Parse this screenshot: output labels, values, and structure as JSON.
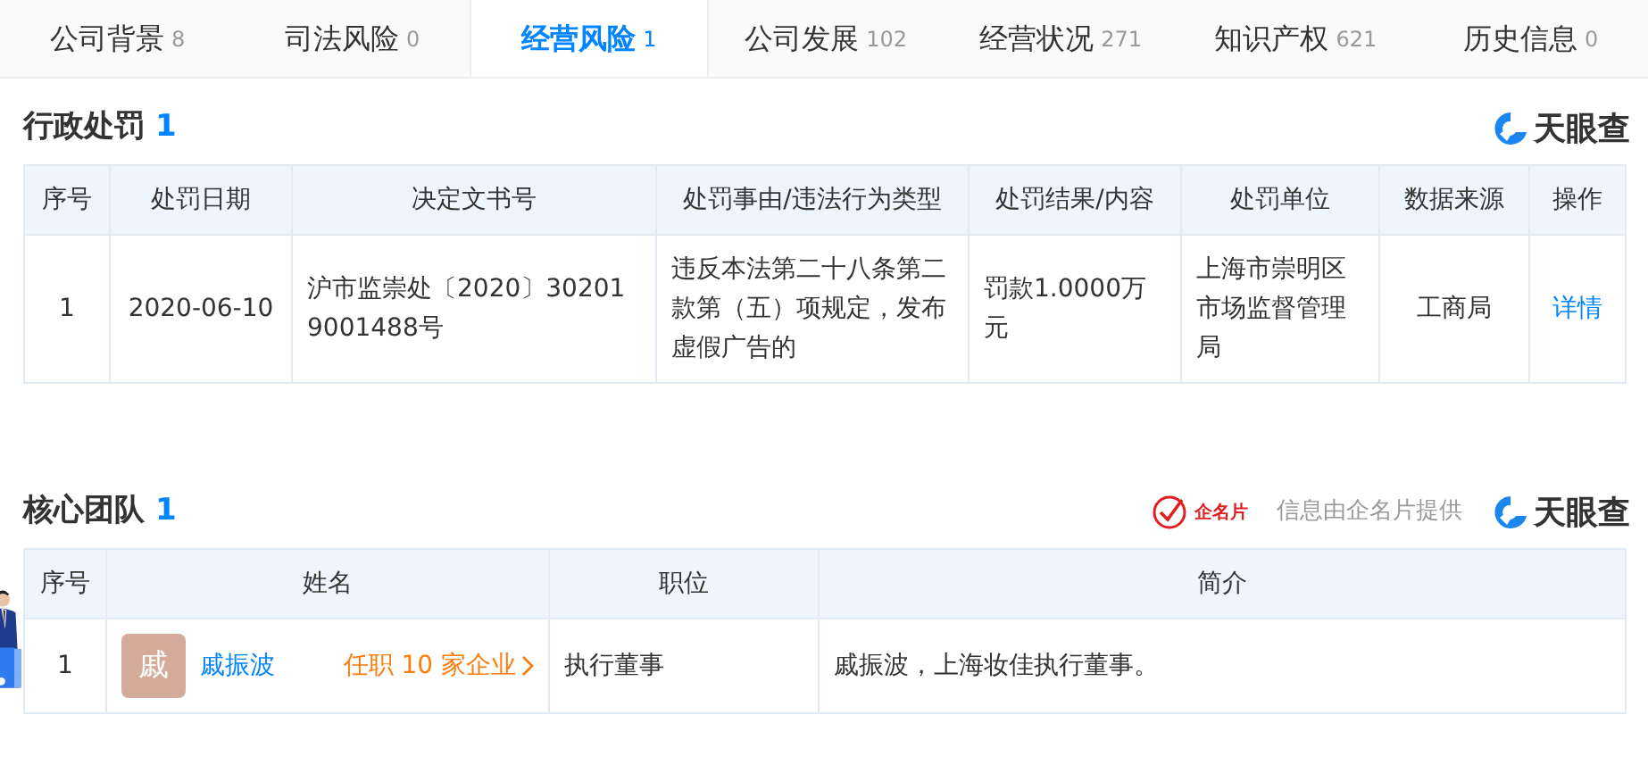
{
  "tabs": [
    {
      "label": "公司背景",
      "count": "8",
      "selected": false
    },
    {
      "label": "司法风险",
      "count": "0",
      "selected": false
    },
    {
      "label": "经营风险",
      "count": "1",
      "selected": true
    },
    {
      "label": "公司发展",
      "count": "102",
      "selected": false
    },
    {
      "label": "经营状况",
      "count": "271",
      "selected": false
    },
    {
      "label": "知识产权",
      "count": "621",
      "selected": false
    },
    {
      "label": "历史信息",
      "count": "0",
      "selected": false
    }
  ],
  "penalties": {
    "title": "行政处罚",
    "count": "1",
    "brand": "天眼查",
    "columns": [
      "序号",
      "处罚日期",
      "决定文书号",
      "处罚事由/违法行为类型",
      "处罚结果/内容",
      "处罚单位",
      "数据来源",
      "操作"
    ],
    "rows": [
      {
        "cells": [
          "1",
          "2020-06-10",
          "沪市监崇处〔2020〕302019001488号",
          "违反本法第二十八条第二款第（五）项规定，发布虚假广告的",
          "罚款1.0000万元",
          "上海市崇明区市场监督管理局",
          "工商局"
        ],
        "action": "详情"
      }
    ]
  },
  "core_team": {
    "title": "核心团队",
    "count": "1",
    "provider_logo": "企名片",
    "provider_note": "信息由企名片提供",
    "brand": "天眼查",
    "columns": [
      "序号",
      "姓名",
      "职位",
      "简介"
    ],
    "rows": [
      {
        "index": "1",
        "avatar": "戚",
        "name": "戚振波",
        "positions_link": "任职 10 家企业",
        "position": "执行董事",
        "bio": "戚振波，上海妆佳执行董事。"
      }
    ]
  }
}
